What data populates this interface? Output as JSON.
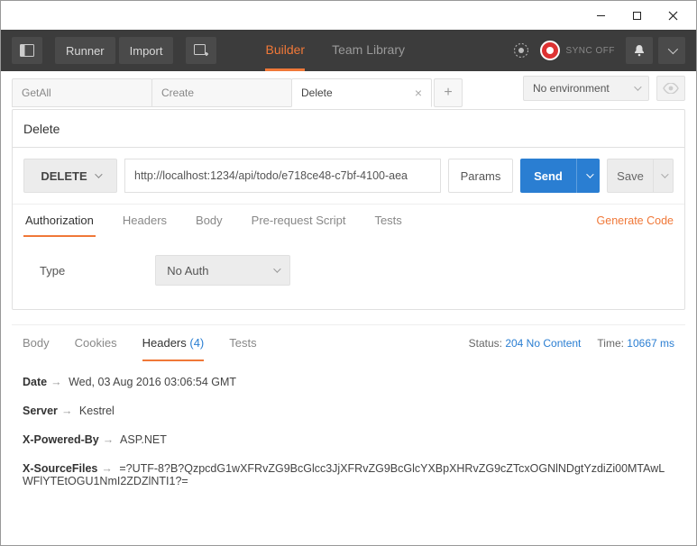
{
  "window": {},
  "topbar": {
    "runner": "Runner",
    "import": "Import",
    "nav": {
      "builder": "Builder",
      "team_library": "Team Library"
    },
    "sync": "SYNC OFF"
  },
  "env": {
    "label": "No environment"
  },
  "tabs": {
    "items": [
      {
        "label": "GetAll"
      },
      {
        "label": "Create"
      },
      {
        "label": "Delete"
      }
    ],
    "active_index": 2
  },
  "request": {
    "name": "Delete",
    "method": "DELETE",
    "url": "http://localhost:1234/api/todo/e718ce48-c7bf-4100-aea",
    "params_label": "Params",
    "send_label": "Send",
    "save_label": "Save"
  },
  "request_subtabs": {
    "items": [
      "Authorization",
      "Headers",
      "Body",
      "Pre-request Script",
      "Tests"
    ],
    "active_index": 0,
    "generate_code": "Generate Code"
  },
  "auth": {
    "type_label": "Type",
    "selected": "No Auth"
  },
  "response": {
    "tabs": {
      "body": "Body",
      "cookies": "Cookies",
      "headers": "Headers",
      "headers_count": "(4)",
      "tests": "Tests"
    },
    "status_label": "Status:",
    "status_value": "204 No Content",
    "time_label": "Time:",
    "time_value": "10667 ms",
    "headers": [
      {
        "name": "Date",
        "value": "Wed, 03 Aug 2016 03:06:54 GMT"
      },
      {
        "name": "Server",
        "value": "Kestrel"
      },
      {
        "name": "X-Powered-By",
        "value": "ASP.NET"
      },
      {
        "name": "X-SourceFiles",
        "value": "=?UTF-8?B?QzpcdG1wXFRvZG9BcGlcc3JjXFRvZG9BcGlcYXBpXHRvZG9cZTcxOGNlNDgtYzdiZi00MTAwLWFlYTEtOGU1NmI2ZDZlNTI1?="
      }
    ]
  }
}
